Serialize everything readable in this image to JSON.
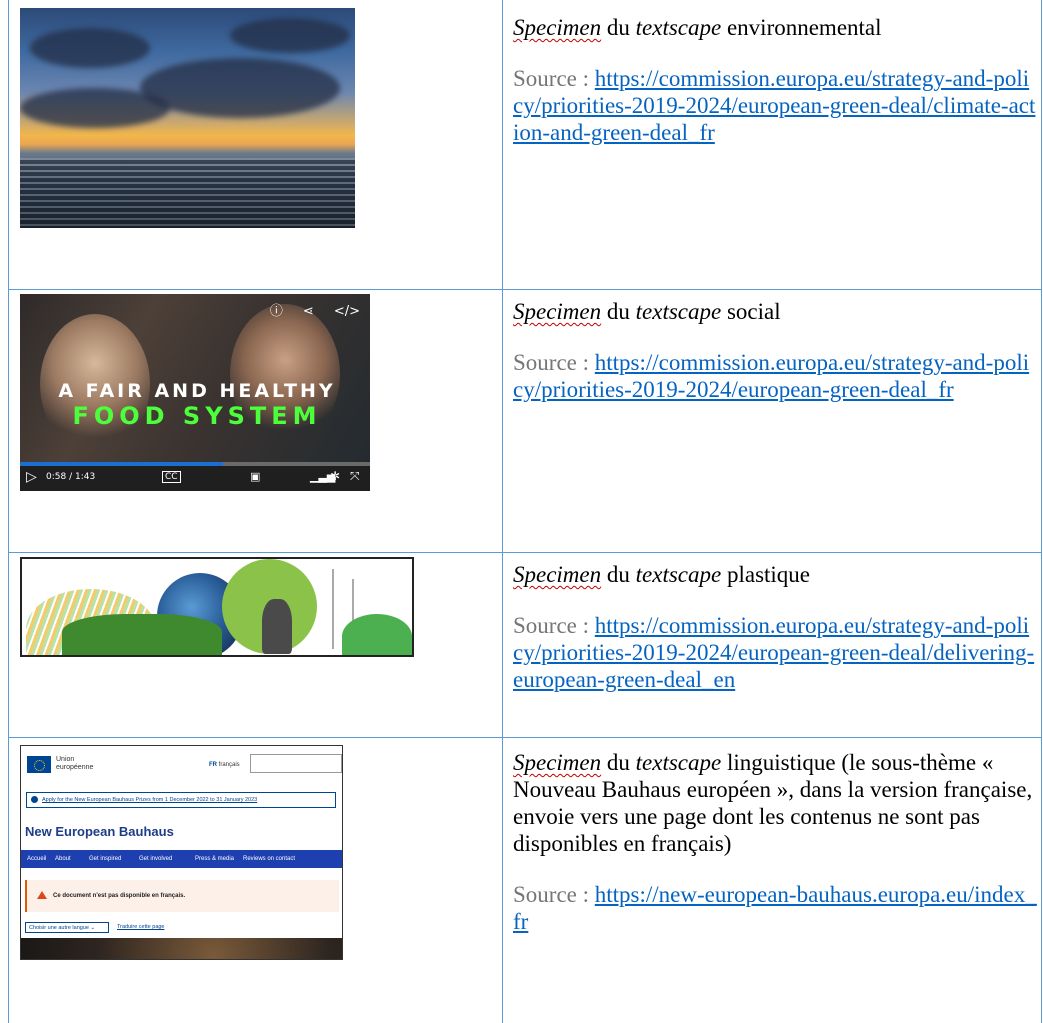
{
  "rows": [
    {
      "specimen": "Specimen",
      "du": " du ",
      "textscape": "textscape",
      "rest": " environnemental",
      "source_label": "Source : ",
      "link": "https://commission.europa.eu/strategy-and-policy/priorities-2019-2024/european-green-deal/climate-action-and-green-deal_fr"
    },
    {
      "specimen": "Specimen",
      "du": " du ",
      "textscape": "textscape",
      "rest": " social",
      "source_label": "Source : ",
      "link": "https://commission.europa.eu/strategy-and-policy/priorities-2019-2024/european-green-deal_fr",
      "video": {
        "line1": "A FAIR AND HEALTHY",
        "line2": "FOOD SYSTEM",
        "time": "0:58 / 1:43",
        "cc": "CC",
        "progress": 0.58
      }
    },
    {
      "specimen": "Specimen",
      "du": " du ",
      "textscape": "textscape",
      "rest": " plastique",
      "source_label": "Source : ",
      "link": "https://commission.europa.eu/strategy-and-policy/priorities-2019-2024/european-green-deal/delivering-european-green-deal_en"
    },
    {
      "specimen": "Specimen",
      "du": " du ",
      "textscape": "textscape",
      "rest": " linguistique (le sous-thème « Nouveau Bauhaus européen », dans la version française, envoie vers une page dont les contenus ne sont pas disponibles en français)",
      "source_label": "Source : ",
      "link": "https://new-european-bauhaus.europa.eu/index_fr",
      "website": {
        "eu_line1": "Union",
        "eu_line2": "européenne",
        "lang_code": "FR",
        "lang_name": "français",
        "notice": "Apply for the New European Bauhaus Prizes from 1 December 2022 to 31 January 2023",
        "site_title": "New European Bauhaus",
        "nav": [
          "Accueil",
          "About",
          "Get inspired",
          "Get involved",
          "Press & media",
          "Reviews on contact"
        ],
        "alert": "Ce document n'est pas disponible en français.",
        "choose_lang": "Choisir une autre langue",
        "translate": "Traduire cette page"
      }
    }
  ]
}
